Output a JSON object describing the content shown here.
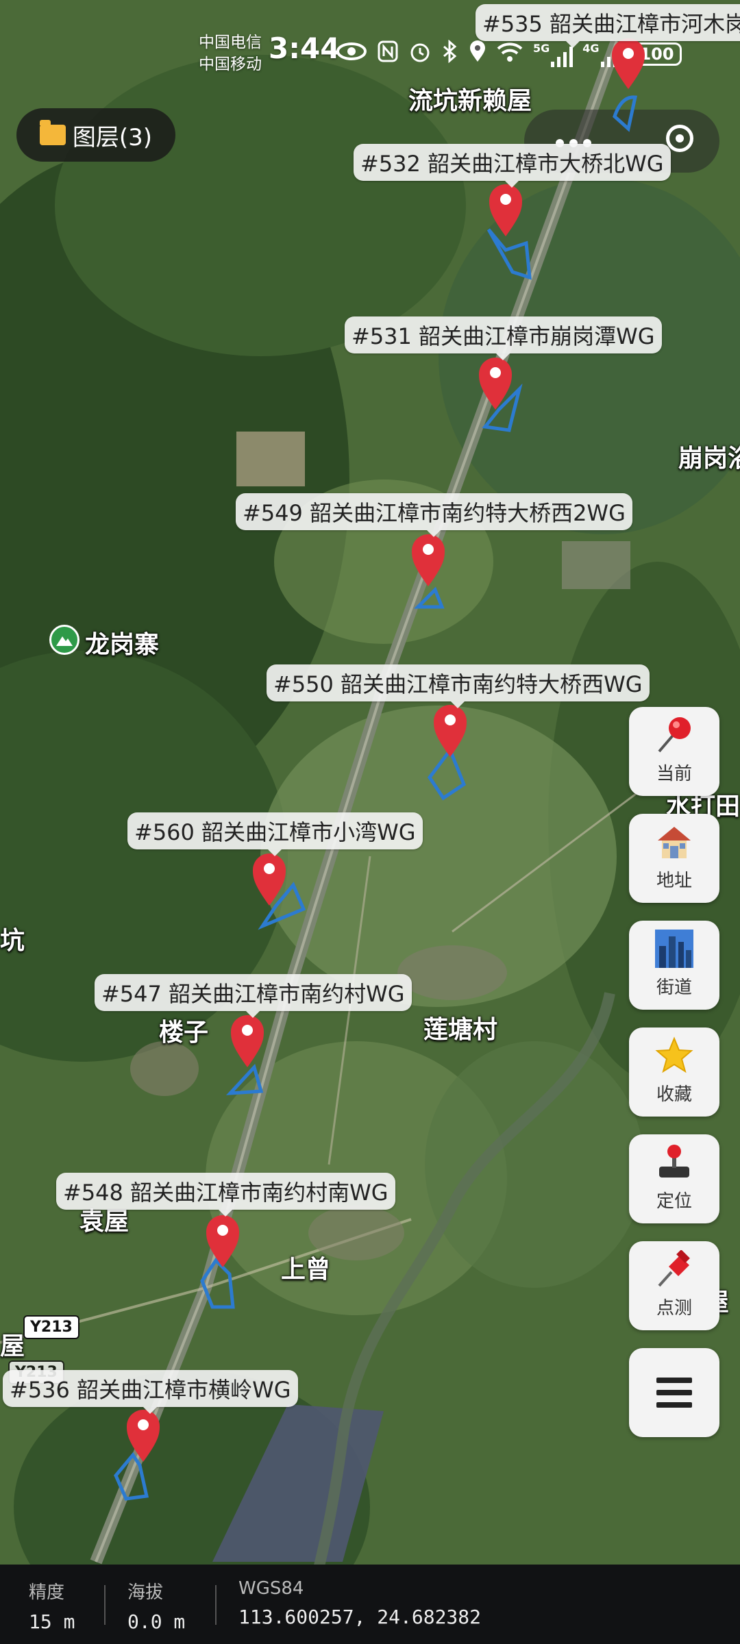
{
  "status_bar": {
    "carrier_1": "中国电信",
    "carrier_2": "中国移动",
    "time": "3:44",
    "network": "5G",
    "network2": "4G",
    "battery": "100"
  },
  "layer_button": {
    "label": "图层(3)"
  },
  "towers": [
    {
      "label": "#535 韶关曲江樟市河木岗"
    },
    {
      "label": "#532 韶关曲江樟市大桥北WG"
    },
    {
      "label": "#531 韶关曲江樟市崩岗潭WG"
    },
    {
      "label": "#549 韶关曲江樟市南约特大桥西2WG"
    },
    {
      "label": "#550 韶关曲江樟市南约特大桥西WG"
    },
    {
      "label": "#560 韶关曲江樟市小湾WG"
    },
    {
      "label": "#547 韶关曲江樟市南约村WG"
    },
    {
      "label": "#548 韶关曲江樟市南约村南WG"
    },
    {
      "label": "#536 韶关曲江樟市横岭WG"
    }
  ],
  "places": {
    "liukeng": "流坑新赖屋",
    "benggang": "崩岗浴",
    "longgangzhai": "龙岗寨",
    "shuidatian": "水打田",
    "keng": "坑",
    "louzi": "楼子",
    "liantang": "莲塘村",
    "yuanwu": "袁屋",
    "shangzeng": "上曾",
    "hewu": "河屋",
    "wu": "屋"
  },
  "road_badges": [
    "Y213",
    "Y213"
  ],
  "side_buttons": [
    {
      "label": "当前",
      "icon": "red-pin-icon"
    },
    {
      "label": "地址",
      "icon": "house-icon"
    },
    {
      "label": "街道",
      "icon": "city-icon"
    },
    {
      "label": "收藏",
      "icon": "star-icon"
    },
    {
      "label": "定位",
      "icon": "joystick-icon"
    },
    {
      "label": "点测",
      "icon": "pushpin-icon"
    },
    {
      "label": "",
      "icon": "menu-icon"
    }
  ],
  "bottom_info": {
    "accuracy_label": "精度",
    "accuracy_value": "15 m",
    "altitude_label": "海拔",
    "altitude_value": "0.0 m",
    "coord_label": "WGS84",
    "coord_value": "113.600257, 24.682382"
  },
  "colors": {
    "pin": "#e0303a",
    "sector": "#2c7bd0",
    "overlay_dark": "#111214"
  }
}
